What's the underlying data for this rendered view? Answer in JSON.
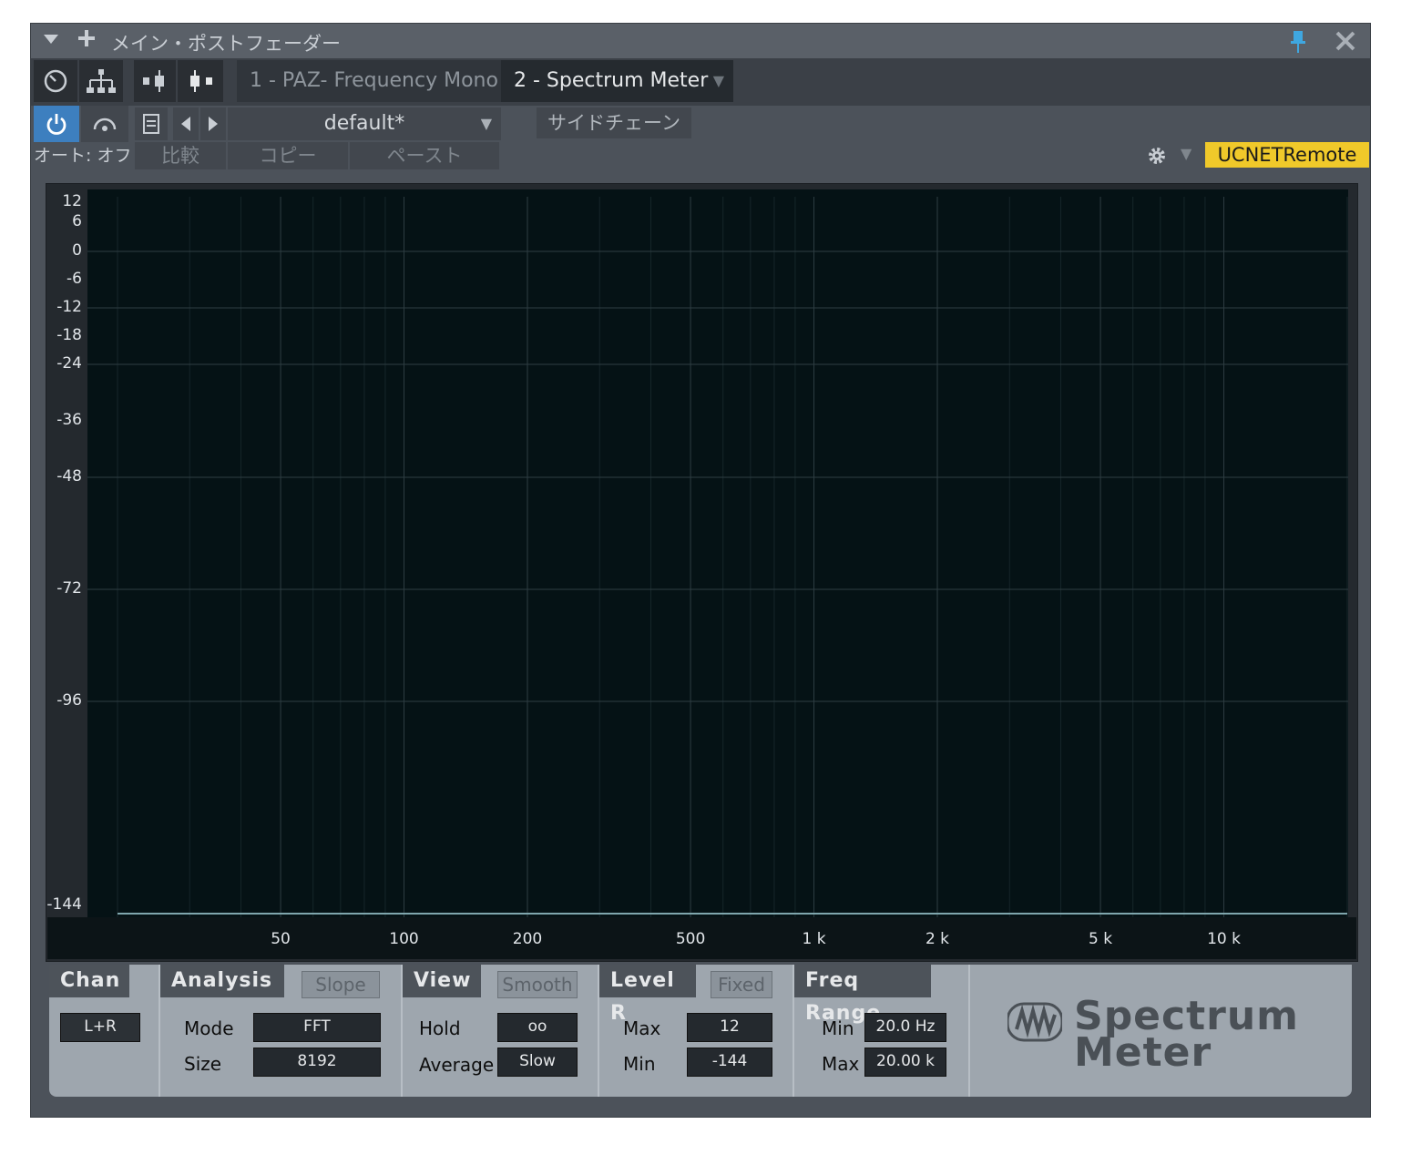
{
  "window": {
    "title": "メイン・ポストフェーダー",
    "menu_icon": "triangle-down-icon",
    "add_icon": "plus-icon",
    "pin_icon": "pin-icon",
    "close_icon": "close-icon"
  },
  "plugin_tabs": [
    {
      "label": "1 - PAZ- Frequency Mono",
      "active": false
    },
    {
      "label": "2 - Spectrum Meter",
      "active": true
    }
  ],
  "toolbar": {
    "preset_name": "default*",
    "sidechain_label": "サイドチェーン",
    "auto_label": "オート: オフ",
    "compare_label": "比較",
    "copy_label": "コピー",
    "paste_label": "ペースト",
    "ucnet_label": "UCNETRemote",
    "ucnet_color": "#f0c92a",
    "power_color": "#3d7fbf"
  },
  "chart_data": {
    "type": "line",
    "title": "",
    "xlabel": "",
    "ylabel": "",
    "x_scale": "log",
    "xlim": [
      20,
      20000
    ],
    "ylim": [
      -144,
      12
    ],
    "y_ticks": [
      "12",
      "6",
      "0",
      "-6",
      "-12",
      "-18",
      "-24",
      "-36",
      "-48",
      "-72",
      "-96",
      "-144"
    ],
    "x_ticks": [
      "50",
      "100",
      "200",
      "500",
      "1 k",
      "2 k",
      "5 k",
      "10 k"
    ],
    "grid": true,
    "series": [
      {
        "values": [
          -144,
          -144
        ],
        "x": [
          20,
          20000
        ]
      }
    ]
  },
  "controls": {
    "chan": {
      "title": "Chan",
      "value": "L+R"
    },
    "analysis": {
      "title": "Analysis",
      "slope_label": "Slope",
      "mode_label": "Mode",
      "mode_value": "FFT",
      "size_label": "Size",
      "size_value": "8192"
    },
    "view": {
      "title": "View",
      "smooth_label": "Smooth",
      "hold_label": "Hold",
      "hold_value": "oo",
      "average_label": "Average",
      "average_value": "Slow"
    },
    "level": {
      "title": "Level R",
      "fixed_label": "Fixed",
      "max_label": "Max",
      "max_value": "12",
      "min_label": "Min",
      "min_value": "-144"
    },
    "freq": {
      "title": "Freq Range",
      "min_label": "Min",
      "min_value": "20.0 Hz",
      "max_label": "Max",
      "max_value": "20.00 k"
    }
  },
  "branding": {
    "line1": "Spectrum",
    "line2": "Meter"
  }
}
